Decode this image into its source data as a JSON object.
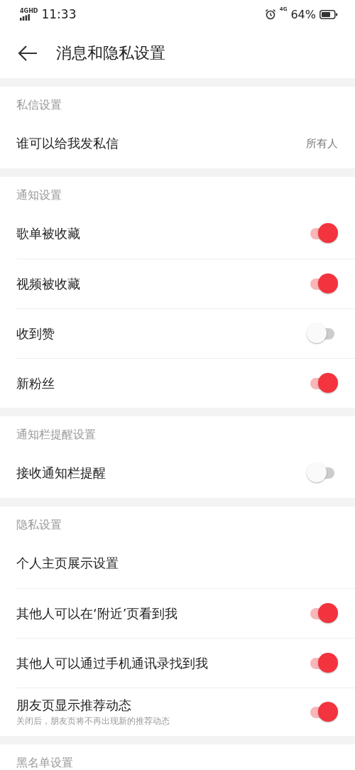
{
  "status_bar": {
    "network": "4GHD",
    "time": "11:33",
    "network_2": "4G",
    "battery": "64%"
  },
  "header": {
    "title": "消息和隐私设置"
  },
  "sections": [
    {
      "title": "私信设置",
      "rows": [
        {
          "kind": "value",
          "label": "谁可以给我发私信",
          "value": "所有人"
        }
      ]
    },
    {
      "title": "通知设置",
      "rows": [
        {
          "kind": "toggle",
          "label": "歌单被收藏",
          "on": true
        },
        {
          "kind": "toggle",
          "label": "视频被收藏",
          "on": true
        },
        {
          "kind": "toggle",
          "label": "收到赞",
          "on": false
        },
        {
          "kind": "toggle",
          "label": "新粉丝",
          "on": true
        }
      ]
    },
    {
      "title": "通知栏提醒设置",
      "rows": [
        {
          "kind": "toggle",
          "label": "接收通知栏提醒",
          "on": false
        }
      ]
    },
    {
      "title": "隐私设置",
      "rows": [
        {
          "kind": "link",
          "label": "个人主页展示设置"
        },
        {
          "kind": "toggle",
          "label": "其他人可以在‘附近’页看到我",
          "on": true
        },
        {
          "kind": "toggle",
          "label": "其他人可以通过手机通讯录找到我",
          "on": true
        },
        {
          "kind": "toggle",
          "label": "朋友页显示推荐动态",
          "note": "关闭后，朋友页将不再出现新的推荐动态",
          "on": true
        }
      ]
    },
    {
      "title": "黑名单设置"
    }
  ]
}
